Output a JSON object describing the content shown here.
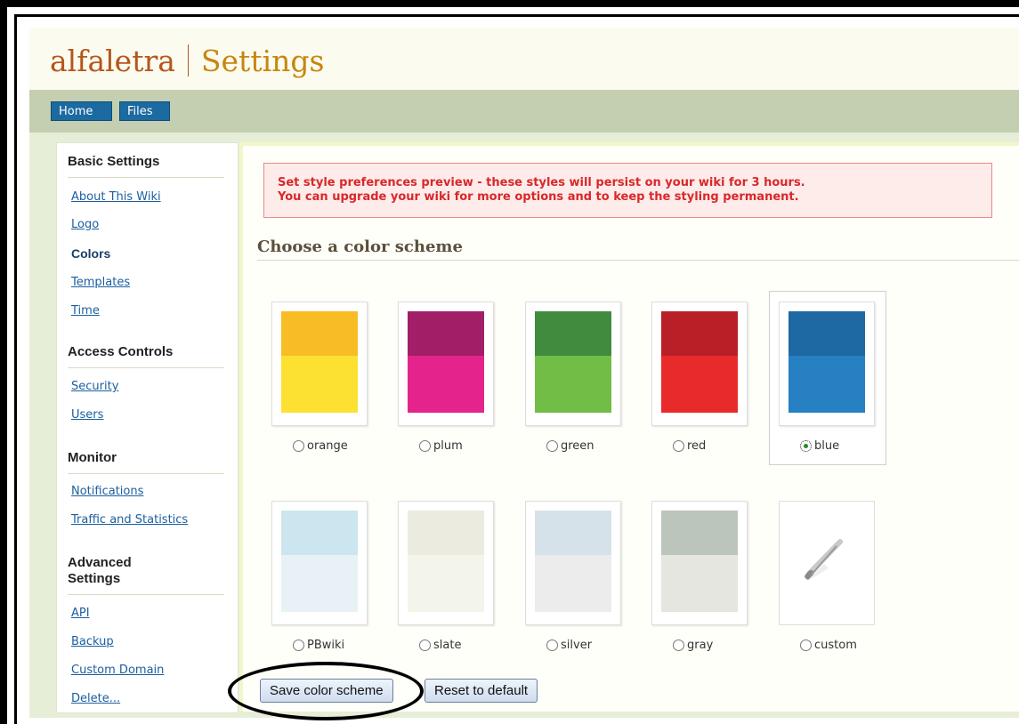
{
  "header": {
    "site_name": "alfaletra",
    "page_title": "Settings"
  },
  "nav": {
    "home": "Home",
    "files": "Files"
  },
  "sidebar": {
    "basic_settings": "Basic Settings",
    "about": "About This Wiki",
    "logo": "Logo",
    "colors": "Colors",
    "templates": "Templates",
    "time": "Time",
    "access_controls": "Access Controls",
    "security": "Security",
    "users": "Users",
    "monitor": "Monitor",
    "notifications": "Notifications",
    "traffic": "Traffic and Statistics",
    "advanced_settings": "Advanced Settings",
    "api": "API",
    "backup": "Backup",
    "custom_domain": "Custom Domain",
    "delete": "Delete..."
  },
  "alert": {
    "line1": "Set style preferences preview - these styles will persist on your wiki for 3 hours.",
    "line2": "You can upgrade your wiki for more options and to keep the styling permanent."
  },
  "section_title": "Choose a color scheme",
  "schemes": [
    {
      "name": "orange",
      "top": "#f8bd24",
      "bottom": "#fde132",
      "selected": false
    },
    {
      "name": "plum",
      "top": "#a21e66",
      "bottom": "#e5238c",
      "selected": false
    },
    {
      "name": "green",
      "top": "#408b3e",
      "bottom": "#71bd45",
      "selected": false
    },
    {
      "name": "red",
      "top": "#b91f27",
      "bottom": "#e92a2b",
      "selected": false
    },
    {
      "name": "blue",
      "top": "#1e68a3",
      "bottom": "#2680c2",
      "selected": true
    },
    {
      "name": "PBwiki",
      "top": "#cbe6ee",
      "bottom": "#e8f2f6",
      "selected": false
    },
    {
      "name": "slate",
      "top": "#ebebdf",
      "bottom": "#f4f5ea",
      "selected": false
    },
    {
      "name": "silver",
      "top": "#d6e2ea",
      "bottom": "#ececec",
      "selected": false
    },
    {
      "name": "gray",
      "top": "#bcc5bc",
      "bottom": "#e4e6df",
      "selected": false
    },
    {
      "name": "custom",
      "icon": "paintbrush-icon",
      "selected": false
    }
  ],
  "buttons": {
    "save": "Save color scheme",
    "reset": "Reset to default"
  }
}
